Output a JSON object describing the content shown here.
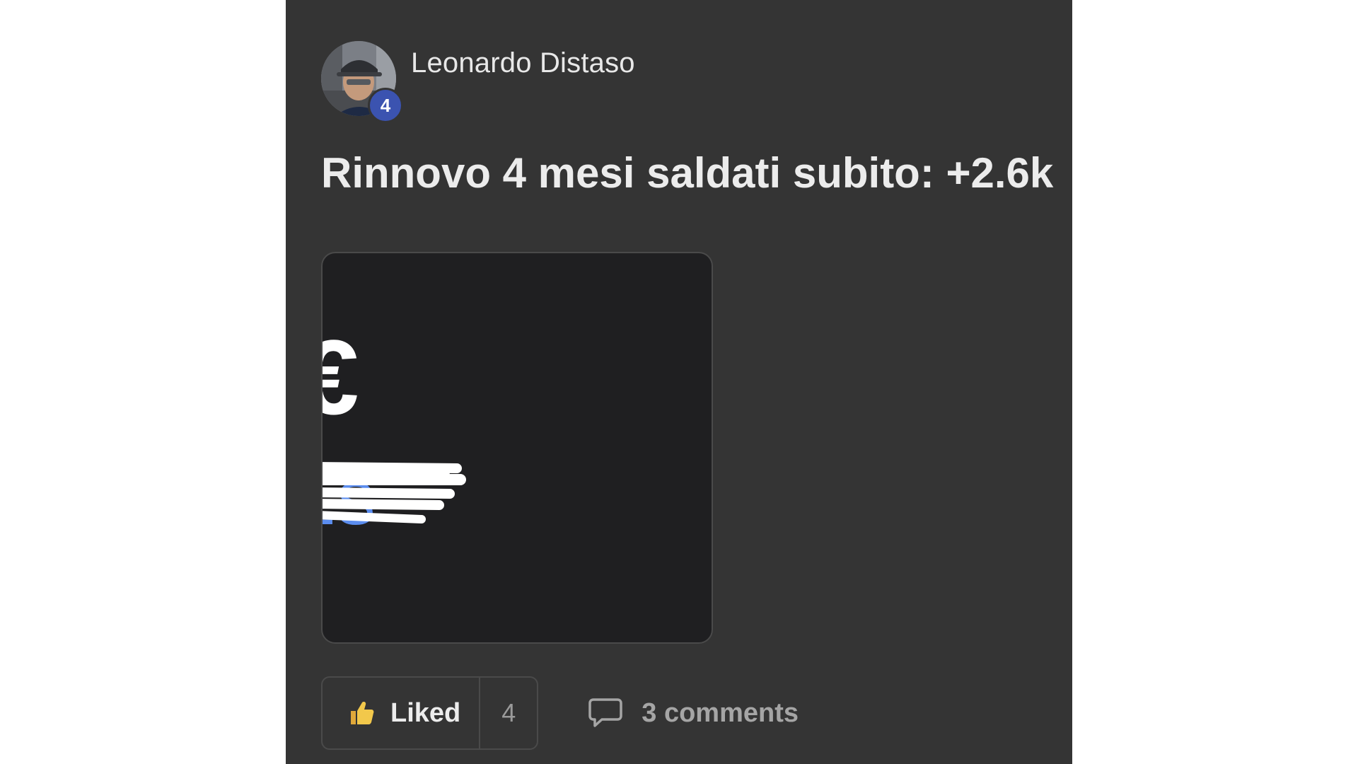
{
  "post": {
    "author": {
      "name": "Leonardo Distaso",
      "level": "4",
      "avatar_icon": "user-photo-avatar"
    },
    "title": "Rinnovo 4 mesi saldati subito: +2.6k",
    "attachment": {
      "glyph": "€",
      "visible_text": "LS",
      "redacted": true,
      "colors": {
        "background": "#1f1f21",
        "accent_text": "#5b8def"
      }
    },
    "actions": {
      "like_label": "Liked",
      "like_count": "4",
      "like_icon": "thumbs-up-icon",
      "comments_label": "3 comments",
      "comments_icon": "speech-bubble-icon"
    }
  },
  "colors": {
    "card_background": "#343434",
    "page_background": "#ffffff",
    "badge": "#3b53b0",
    "thumb": "#f2c84b"
  }
}
